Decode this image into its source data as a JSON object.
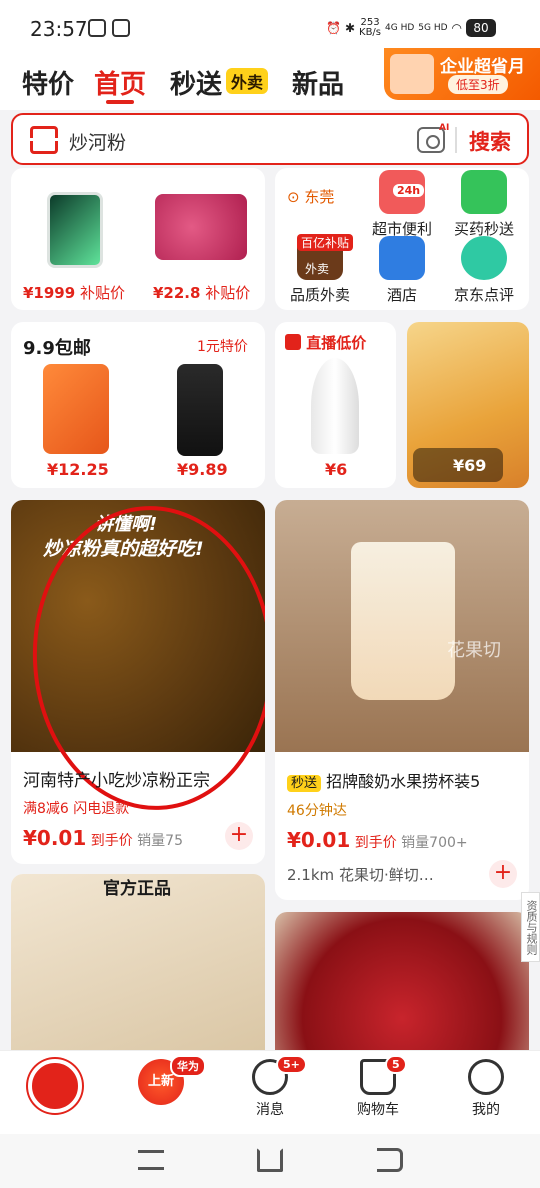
{
  "status": {
    "time": "23:57",
    "speed_top": "253",
    "speed_unit": "KB/s",
    "net_a": "4G HD",
    "net_b": "5G HD",
    "battery": "80"
  },
  "tabs": [
    {
      "label": "特价"
    },
    {
      "label": "首页"
    },
    {
      "label": "秒送"
    },
    {
      "label": "新品"
    }
  ],
  "tab_badge": "外卖",
  "promo": {
    "title": "企业超省月",
    "sub": "低至3折"
  },
  "search": {
    "query": "炒河粉",
    "ai": "AI",
    "button": "搜索"
  },
  "card1": {
    "items": [
      {
        "price": "¥1999",
        "tag": "补贴价"
      },
      {
        "price": "¥22.8",
        "tag": "补贴价"
      }
    ]
  },
  "card2": {
    "location": "东莞",
    "services": [
      {
        "label": "超市便利",
        "badge": "24h"
      },
      {
        "label": "买药秒送"
      },
      {
        "label": "品质外卖",
        "badge": "百亿补贴",
        "inner": "外卖"
      },
      {
        "label": "酒店"
      },
      {
        "label": "京东点评"
      }
    ]
  },
  "card3": {
    "title": "9.9包邮",
    "subtitle": "1元特价",
    "items": [
      {
        "price": "¥12.25"
      },
      {
        "price": "¥9.89"
      }
    ]
  },
  "card4": {
    "title": "直播低价",
    "price": "¥6"
  },
  "card5": {
    "price": "¥69"
  },
  "card6": {
    "overlay1": "讲懂啊!",
    "overlay2": "炒凉粉真的超好吃!",
    "title": "河南特产小吃炒凉粉正宗",
    "promo_a": "满8减6",
    "promo_b": "闪电退款",
    "price": "¥0.01",
    "price_tag": "到手价",
    "sales": "销量75"
  },
  "card7": {
    "watermark": "花果切",
    "badge": "秒送",
    "title": "招牌酸奶水果捞杯装5",
    "delivery": "46分钟达",
    "price": "¥0.01",
    "price_tag": "到手价",
    "sales": "销量700+",
    "distance": "2.1km",
    "shop": "花果切·鲜切…"
  },
  "card8": {
    "label": "官方正品"
  },
  "side_tab": "资质与规则",
  "tabbar": [
    {
      "label": ""
    },
    {
      "label": "上新",
      "badge": "华为"
    },
    {
      "label": "消息",
      "badge": "5+"
    },
    {
      "label": "购物车",
      "badge": "5"
    },
    {
      "label": "我的"
    }
  ]
}
